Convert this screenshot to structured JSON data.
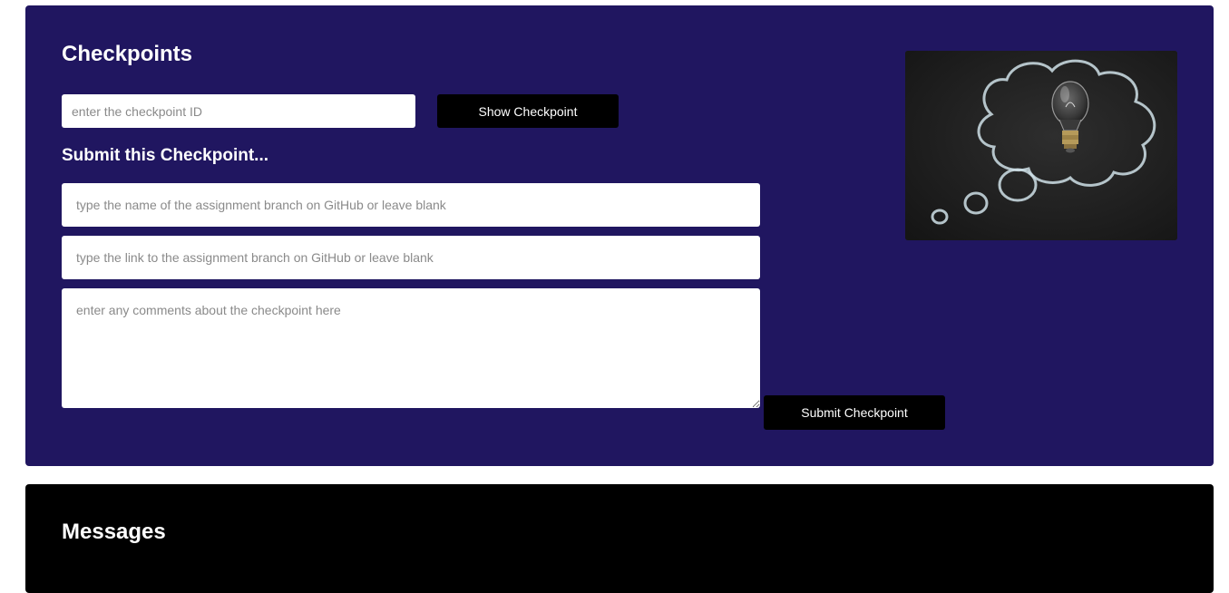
{
  "checkpoints": {
    "title": "Checkpoints",
    "id_input": {
      "placeholder": "enter the checkpoint ID",
      "value": ""
    },
    "show_button_label": "Show Checkpoint",
    "submit_section_title": "Submit this Checkpoint...",
    "branch_name_input": {
      "placeholder": "type the name of the assignment branch on GitHub or leave blank",
      "value": ""
    },
    "branch_link_input": {
      "placeholder": "type the link to the assignment branch on GitHub or leave blank",
      "value": ""
    },
    "comments_input": {
      "placeholder": "enter any comments about the checkpoint here",
      "value": ""
    },
    "submit_button_label": "Submit Checkpoint",
    "illustration": {
      "icon": "lightbulb-thought-bubble-icon"
    }
  },
  "messages": {
    "title": "Messages"
  },
  "colors": {
    "checkpoints_panel_bg": "#201660",
    "messages_panel_bg": "#000000",
    "button_bg": "#000000",
    "text_light": "#ffffff"
  }
}
